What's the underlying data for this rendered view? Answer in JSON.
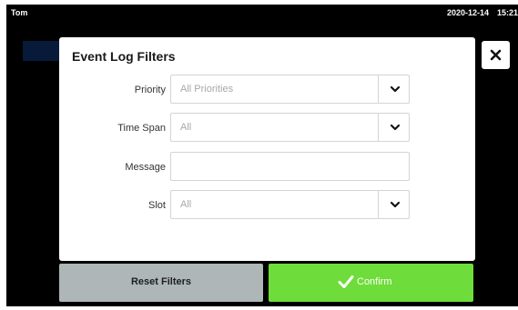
{
  "status_bar": {
    "user": "Tom",
    "date": "2020-12-14",
    "time": "15:21"
  },
  "dialog": {
    "title": "Event Log Filters",
    "fields": {
      "priority": {
        "label": "Priority",
        "value": "All Priorities"
      },
      "time_span": {
        "label": "Time Span",
        "value": "All"
      },
      "message": {
        "label": "Message",
        "value": ""
      },
      "slot": {
        "label": "Slot",
        "value": "All"
      }
    }
  },
  "buttons": {
    "reset": "Reset Filters",
    "confirm": "Confirm"
  },
  "icons": {
    "close": "close-icon",
    "dropdown": "chevron-down-icon",
    "confirm": "check-icon"
  },
  "colors": {
    "background": "#000000",
    "confirm_button": "#6edc3a",
    "reset_button": "#aeb6b8"
  }
}
